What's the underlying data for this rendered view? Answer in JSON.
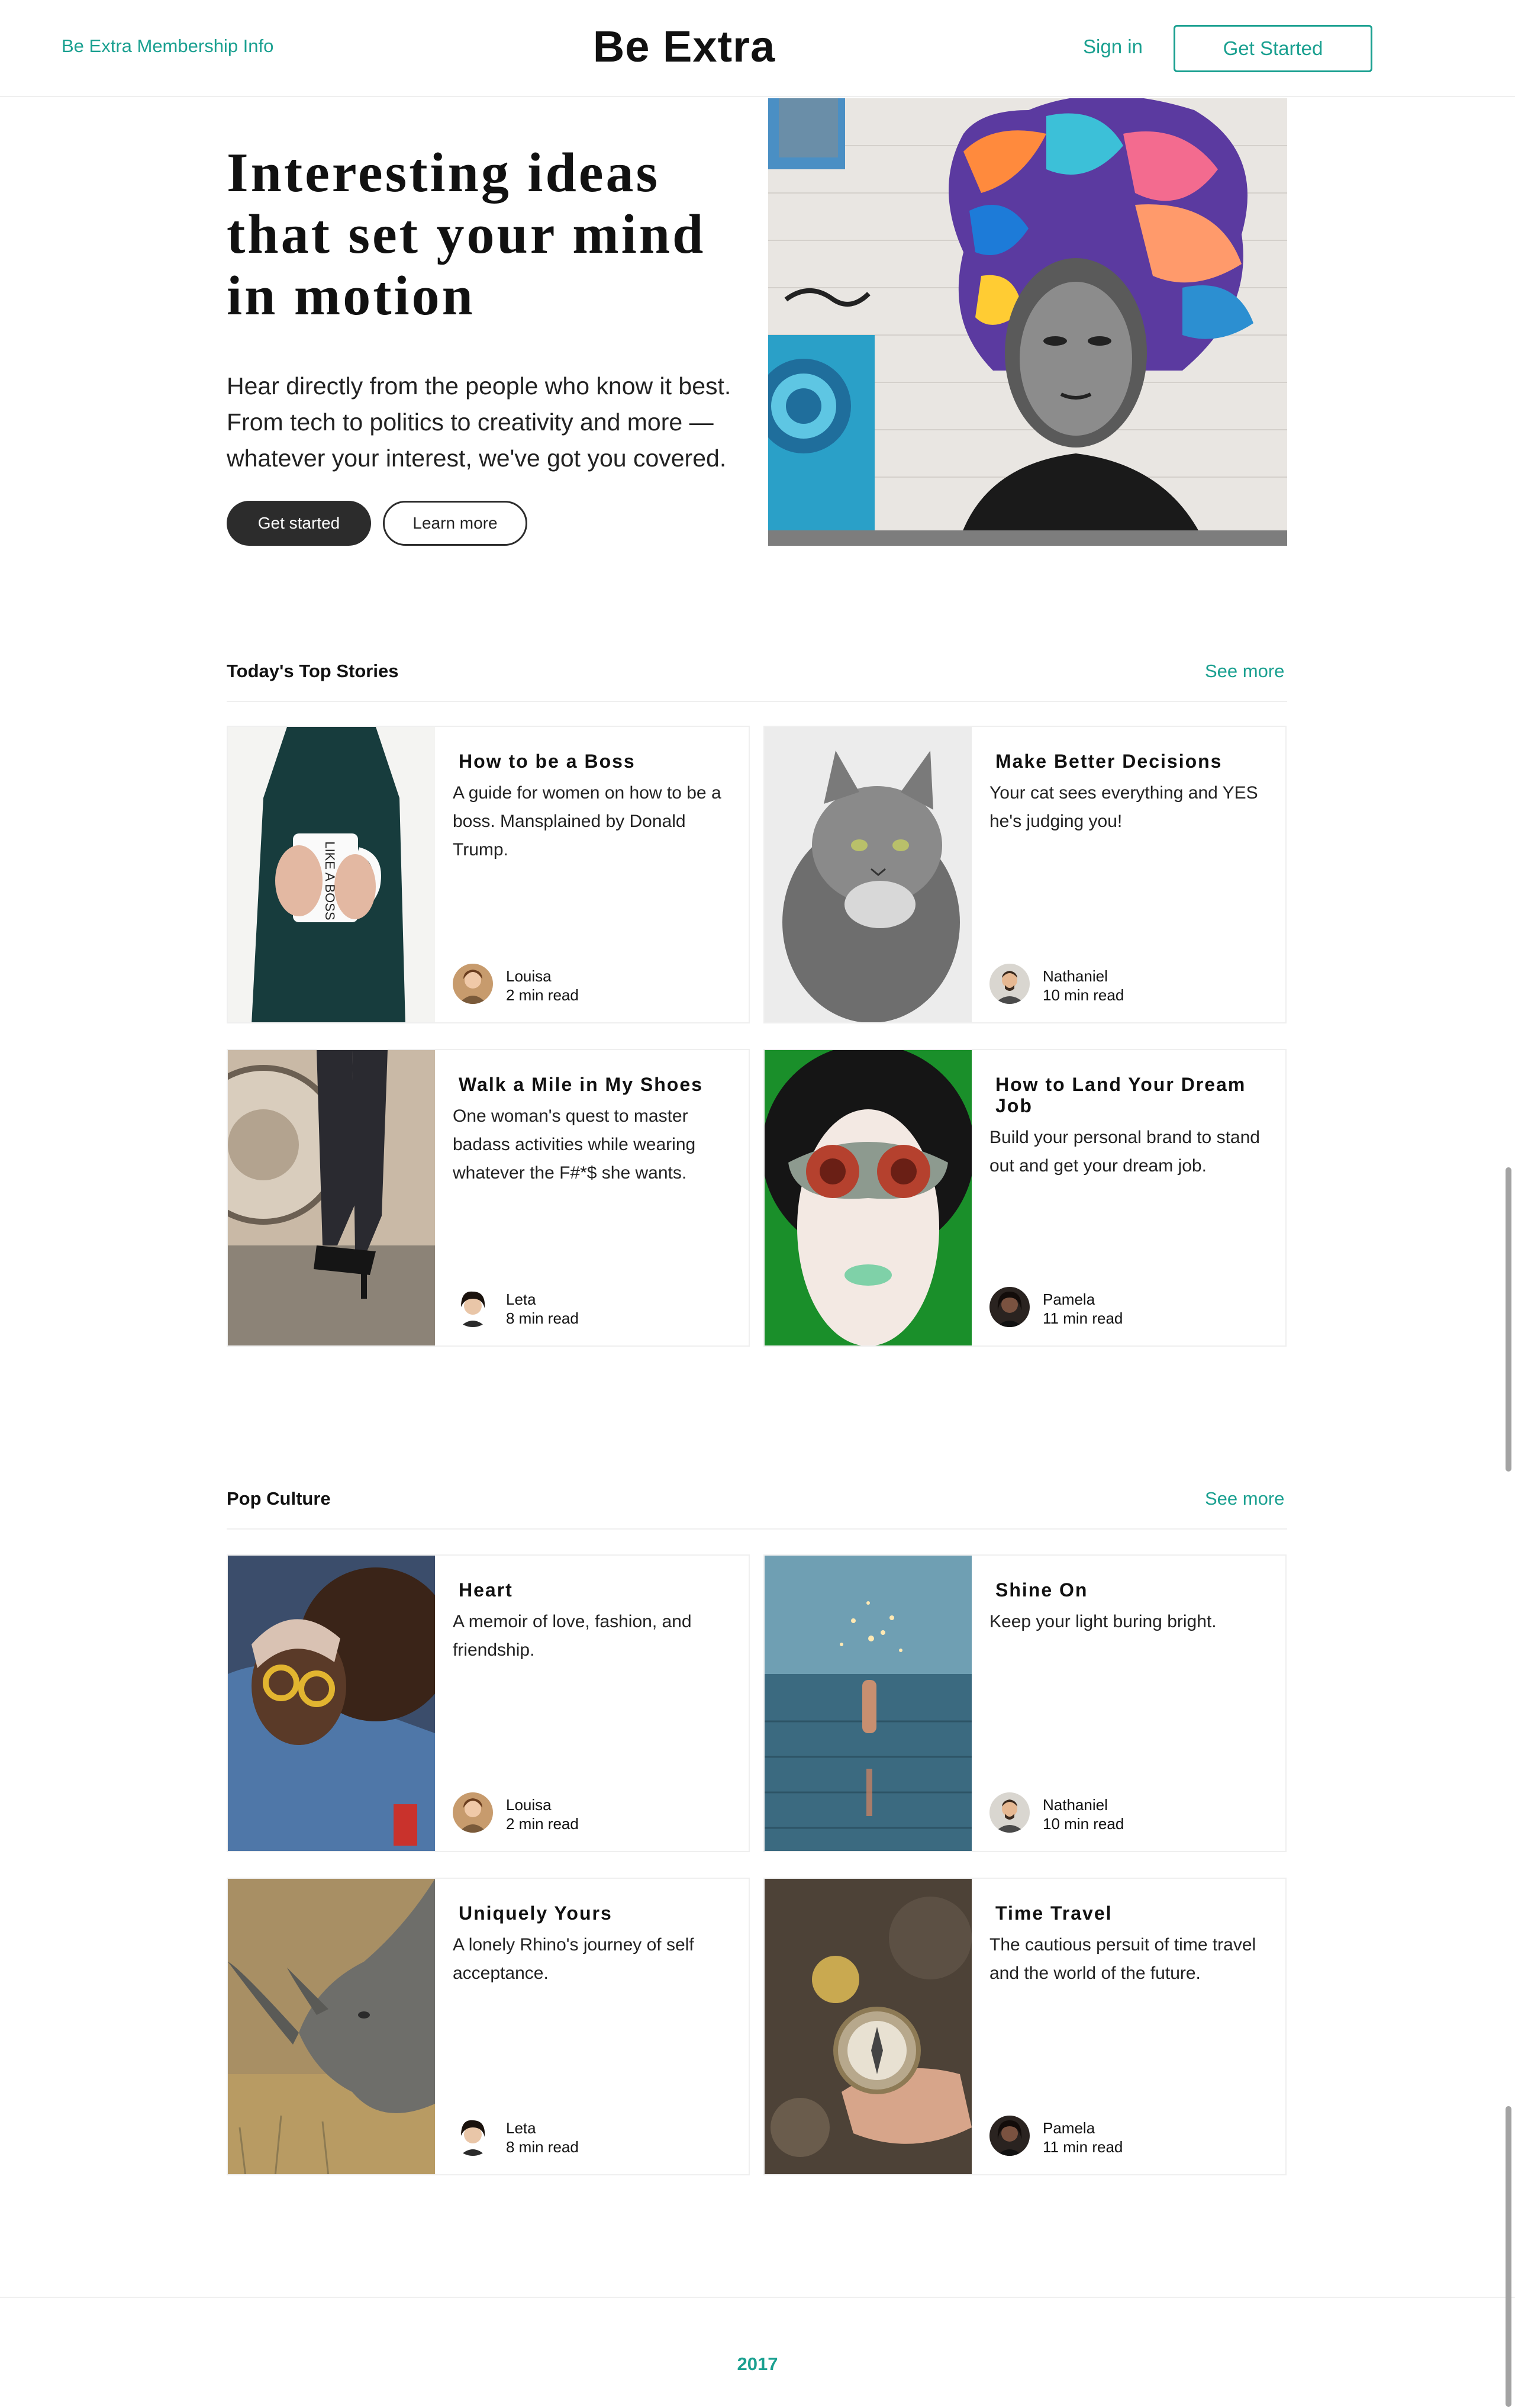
{
  "header": {
    "membership_link": "Be Extra Membership Info",
    "brand": "Be Extra",
    "signin": "Sign in",
    "get_started": "Get Started"
  },
  "hero": {
    "title": "Interesting ideas that set your mind in motion",
    "subtitle": "Hear directly from the people who know it best. From tech to politics to creativity and more — whatever your interest, we've got you covered.",
    "primary_button": "Get started",
    "secondary_button": "Learn more"
  },
  "sections": [
    {
      "title": "Today's Top Stories",
      "see_more": "See more",
      "cards": [
        {
          "title": "How to be a Boss",
          "description": "A guide for women on how to be a boss. Mansplained by Donald Trump.",
          "author": "Louisa",
          "read_time": "2 min read"
        },
        {
          "title": "Make Better Decisions",
          "description": "Your cat sees everything and YES he's judging you!",
          "author": "Nathaniel",
          "read_time": "10 min read"
        },
        {
          "title": "Walk a Mile in My Shoes",
          "description": "One woman's quest to master badass activities while wearing whatever the F#*$ she wants.",
          "author": "Leta",
          "read_time": "8 min read"
        },
        {
          "title": "How to Land Your Dream Job",
          "description": "Build your personal brand to stand out and get your dream job.",
          "author": "Pamela",
          "read_time": "11 min read"
        }
      ]
    },
    {
      "title": "Pop Culture",
      "see_more": "See more",
      "cards": [
        {
          "title": "Heart",
          "description": "A memoir of love, fashion, and friendship.",
          "author": "Louisa",
          "read_time": "2 min read"
        },
        {
          "title": "Shine On",
          "description": "Keep your light buring bright.",
          "author": "Nathaniel",
          "read_time": "10 min read"
        },
        {
          "title": "Uniquely Yours",
          "description": "A lonely Rhino's journey of self acceptance.",
          "author": "Leta",
          "read_time": "8 min read"
        },
        {
          "title": "Time Travel",
          "description": "The cautious persuit of time travel and the world of the future.",
          "author": "Pamela",
          "read_time": "11 min read"
        }
      ]
    }
  ],
  "footer": {
    "year": "2017"
  },
  "colors": {
    "accent": "#1aa090",
    "dark_button": "#2c2c2c",
    "border": "#efefef"
  }
}
